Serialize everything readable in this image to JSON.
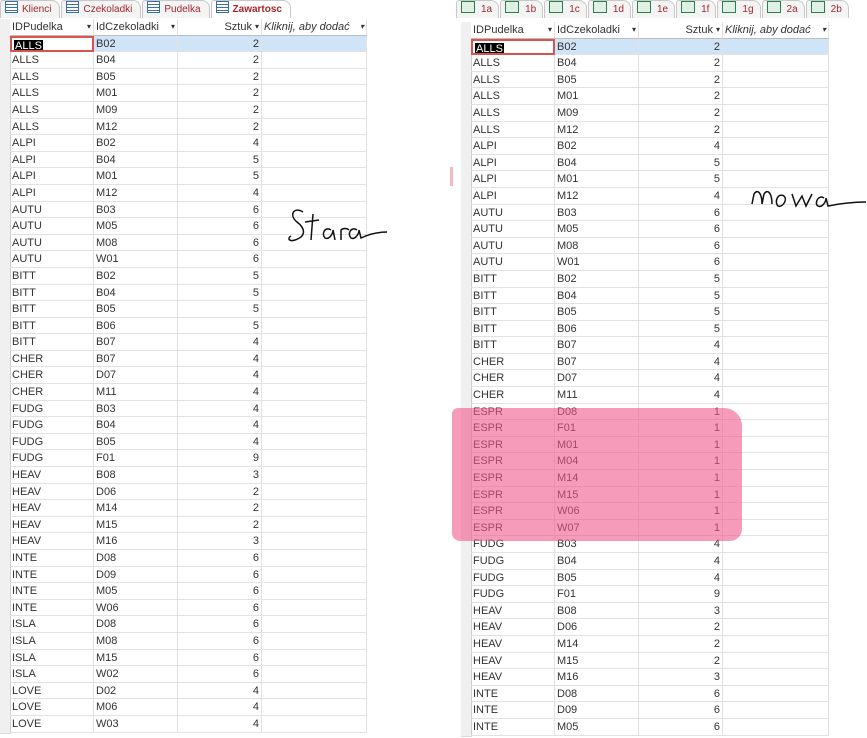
{
  "left": {
    "tabs": [
      {
        "label": "Klienci",
        "active": false
      },
      {
        "label": "Czekoladki",
        "active": false
      },
      {
        "label": "Pudelka",
        "active": false
      },
      {
        "label": "Zawartosc",
        "active": true
      }
    ],
    "columns": [
      "IDPudelka",
      "IdCzekoladki",
      "Sztuk",
      "Kliknij, aby dodać"
    ],
    "rows": [
      [
        "ALLS",
        "B02",
        "2"
      ],
      [
        "ALLS",
        "B04",
        "2"
      ],
      [
        "ALLS",
        "B05",
        "2"
      ],
      [
        "ALLS",
        "M01",
        "2"
      ],
      [
        "ALLS",
        "M09",
        "2"
      ],
      [
        "ALLS",
        "M12",
        "2"
      ],
      [
        "ALPI",
        "B02",
        "4"
      ],
      [
        "ALPI",
        "B04",
        "5"
      ],
      [
        "ALPI",
        "M01",
        "5"
      ],
      [
        "ALPI",
        "M12",
        "4"
      ],
      [
        "AUTU",
        "B03",
        "6"
      ],
      [
        "AUTU",
        "M05",
        "6"
      ],
      [
        "AUTU",
        "M08",
        "6"
      ],
      [
        "AUTU",
        "W01",
        "6"
      ],
      [
        "BITT",
        "B02",
        "5"
      ],
      [
        "BITT",
        "B04",
        "5"
      ],
      [
        "BITT",
        "B05",
        "5"
      ],
      [
        "BITT",
        "B06",
        "5"
      ],
      [
        "BITT",
        "B07",
        "4"
      ],
      [
        "CHER",
        "B07",
        "4"
      ],
      [
        "CHER",
        "D07",
        "4"
      ],
      [
        "CHER",
        "M11",
        "4"
      ],
      [
        "FUDG",
        "B03",
        "4"
      ],
      [
        "FUDG",
        "B04",
        "4"
      ],
      [
        "FUDG",
        "B05",
        "4"
      ],
      [
        "FUDG",
        "F01",
        "9"
      ],
      [
        "HEAV",
        "B08",
        "3"
      ],
      [
        "HEAV",
        "D06",
        "2"
      ],
      [
        "HEAV",
        "M14",
        "2"
      ],
      [
        "HEAV",
        "M15",
        "2"
      ],
      [
        "HEAV",
        "M16",
        "3"
      ],
      [
        "INTE",
        "D08",
        "6"
      ],
      [
        "INTE",
        "D09",
        "6"
      ],
      [
        "INTE",
        "M05",
        "6"
      ],
      [
        "INTE",
        "W06",
        "6"
      ],
      [
        "ISLA",
        "D08",
        "6"
      ],
      [
        "ISLA",
        "M08",
        "6"
      ],
      [
        "ISLA",
        "M15",
        "6"
      ],
      [
        "ISLA",
        "W02",
        "6"
      ],
      [
        "LOVE",
        "D02",
        "4"
      ],
      [
        "LOVE",
        "M06",
        "4"
      ],
      [
        "LOVE",
        "W03",
        "4"
      ]
    ],
    "annotation": "Stara"
  },
  "right": {
    "tabs": [
      {
        "label": "1a"
      },
      {
        "label": "1b"
      },
      {
        "label": "1c"
      },
      {
        "label": "1d"
      },
      {
        "label": "1e"
      },
      {
        "label": "1f"
      },
      {
        "label": "1g"
      },
      {
        "label": "2a"
      },
      {
        "label": "2b"
      }
    ],
    "columns": [
      "IDPudelka",
      "IdCzekoladki",
      "Sztuk",
      "Kliknij, aby dodać"
    ],
    "rows": [
      [
        "ALLS",
        "B02",
        "2"
      ],
      [
        "ALLS",
        "B04",
        "2"
      ],
      [
        "ALLS",
        "B05",
        "2"
      ],
      [
        "ALLS",
        "M01",
        "2"
      ],
      [
        "ALLS",
        "M09",
        "2"
      ],
      [
        "ALLS",
        "M12",
        "2"
      ],
      [
        "ALPI",
        "B02",
        "4"
      ],
      [
        "ALPI",
        "B04",
        "5"
      ],
      [
        "ALPI",
        "M01",
        "5"
      ],
      [
        "ALPI",
        "M12",
        "4"
      ],
      [
        "AUTU",
        "B03",
        "6"
      ],
      [
        "AUTU",
        "M05",
        "6"
      ],
      [
        "AUTU",
        "M08",
        "6"
      ],
      [
        "AUTU",
        "W01",
        "6"
      ],
      [
        "BITT",
        "B02",
        "5"
      ],
      [
        "BITT",
        "B04",
        "5"
      ],
      [
        "BITT",
        "B05",
        "5"
      ],
      [
        "BITT",
        "B06",
        "5"
      ],
      [
        "BITT",
        "B07",
        "4"
      ],
      [
        "CHER",
        "B07",
        "4"
      ],
      [
        "CHER",
        "D07",
        "4"
      ],
      [
        "CHER",
        "M11",
        "4"
      ],
      [
        "ESPR",
        "D08",
        "1"
      ],
      [
        "ESPR",
        "F01",
        "1"
      ],
      [
        "ESPR",
        "M01",
        "1"
      ],
      [
        "ESPR",
        "M04",
        "1"
      ],
      [
        "ESPR",
        "M14",
        "1"
      ],
      [
        "ESPR",
        "M15",
        "1"
      ],
      [
        "ESPR",
        "W06",
        "1"
      ],
      [
        "ESPR",
        "W07",
        "1"
      ],
      [
        "FUDG",
        "B03",
        "4"
      ],
      [
        "FUDG",
        "B04",
        "4"
      ],
      [
        "FUDG",
        "B05",
        "4"
      ],
      [
        "FUDG",
        "F01",
        "9"
      ],
      [
        "HEAV",
        "B08",
        "3"
      ],
      [
        "HEAV",
        "D06",
        "2"
      ],
      [
        "HEAV",
        "M14",
        "2"
      ],
      [
        "HEAV",
        "M15",
        "2"
      ],
      [
        "HEAV",
        "M16",
        "3"
      ],
      [
        "INTE",
        "D08",
        "6"
      ],
      [
        "INTE",
        "D09",
        "6"
      ],
      [
        "INTE",
        "M05",
        "6"
      ]
    ],
    "annotation": "nowa",
    "highlight_color": "#f05a8c"
  },
  "colors": {
    "header_accent": "#a4262c",
    "selected_row": "#cfe4f7",
    "grid_line": "#e2e2e2"
  }
}
